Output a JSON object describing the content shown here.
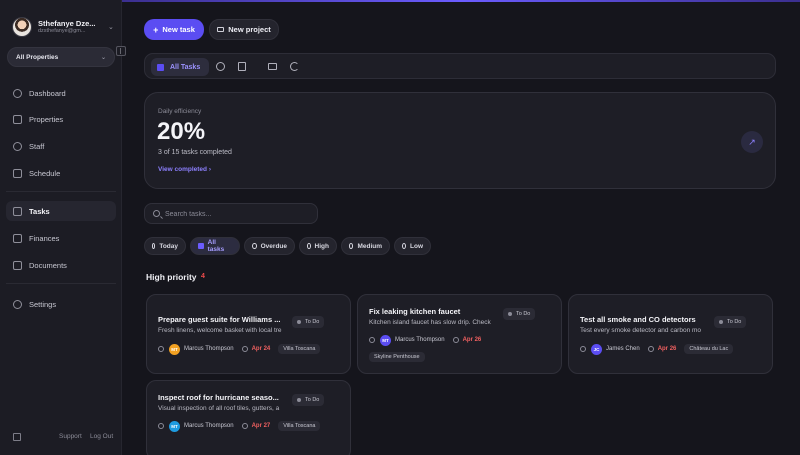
{
  "user": {
    "name": "Sthefanye Dze...",
    "email": "dzsthefanye@gm..."
  },
  "property_select": {
    "value": "All Properties"
  },
  "nav": [
    {
      "label": "Dashboard",
      "icon": "dashboard-icon"
    },
    {
      "label": "Properties",
      "icon": "building-icon"
    },
    {
      "label": "Staff",
      "icon": "users-icon"
    },
    {
      "label": "Schedule",
      "icon": "calendar-icon"
    },
    {
      "label": "Tasks",
      "icon": "tasks-icon",
      "active": true
    },
    {
      "label": "Finances",
      "icon": "finance-icon"
    },
    {
      "label": "Documents",
      "icon": "folder-icon"
    },
    {
      "label": "Settings",
      "icon": "gear-icon"
    }
  ],
  "footer": {
    "support": "Support",
    "logout": "Log Out"
  },
  "actions": {
    "new_task": "New task",
    "new_project": "New project"
  },
  "toolbar": {
    "active_tab": "All Tasks"
  },
  "efficiency": {
    "label": "Daily efficiency",
    "value": "20%",
    "summary": "3 of 15 tasks completed",
    "link": "View completed"
  },
  "search": {
    "placeholder": "Search tasks..."
  },
  "filters": [
    {
      "label": "Today"
    },
    {
      "label": "All tasks",
      "active": true
    },
    {
      "label": "Overdue"
    },
    {
      "label": "High"
    },
    {
      "label": "Medium"
    },
    {
      "label": "Low"
    }
  ],
  "section": {
    "title": "High priority",
    "count": "4"
  },
  "tasks": [
    {
      "title": "Prepare guest suite for Williams ...",
      "description": "Fresh linens, welcome basket with local tre",
      "status": "To Do",
      "assignee": "Marcus Thompson",
      "initials": "MT",
      "avatar_color": "#f2a122",
      "due": "Apr 24",
      "location": "Villa Toscana"
    },
    {
      "title": "Fix leaking kitchen faucet",
      "description": "Kitchen island faucet has slow drip. Check",
      "status": "To Do",
      "assignee": "Marcus Thompson",
      "initials": "MT",
      "avatar_color": "#5b4df2",
      "due": "Apr 26",
      "location": "Skyline Penthouse"
    },
    {
      "title": "Test all smoke and CO detectors",
      "description": "Test every smoke detector and carbon mo",
      "status": "To Do",
      "assignee": "James Chen",
      "initials": "JC",
      "avatar_color": "#5b4df2",
      "due": "Apr 26",
      "location": "Château du Lac"
    },
    {
      "title": "Inspect roof for hurricane seaso...",
      "description": "Visual inspection of all roof tiles, gutters, a",
      "status": "To Do",
      "assignee": "Marcus Thompson",
      "initials": "MT",
      "avatar_color": "#1e9be0",
      "due": "Apr 27",
      "location": "Villa Toscana"
    }
  ]
}
